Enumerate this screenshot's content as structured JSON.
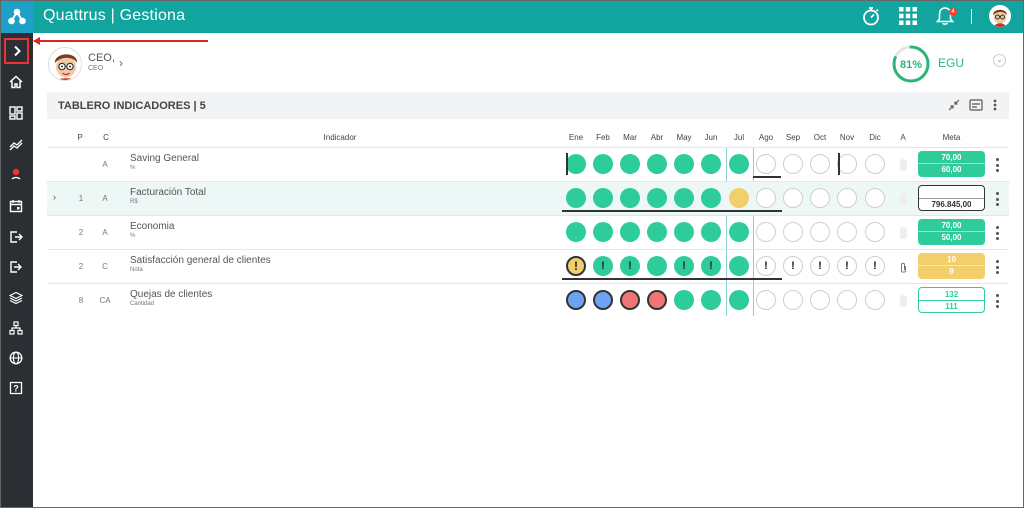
{
  "topbar": {
    "title": "Quattrus | Gestiona",
    "notification_count": "4"
  },
  "icons": {
    "logo": "quattrus-logo-icon",
    "timer": "stopwatch-icon",
    "apps": "grid-apps-icon",
    "bell": "bell-icon"
  },
  "sidebar": {
    "items": [
      "chevron-right-icon",
      "home-icon",
      "dashboard-icon",
      "trend-icon",
      "location-icon",
      "calendar-icon",
      "logout-icon",
      "export-icon",
      "layers-icon",
      "org-chart-icon",
      "globe-icon",
      "help-icon"
    ]
  },
  "user": {
    "name": "CEO,",
    "role": "CEO",
    "chevron": "›"
  },
  "egu": {
    "percent": "81%",
    "label": "EGU",
    "value": 0.81,
    "color": "#2bb673"
  },
  "panel": {
    "title": "TABLERO INDICADORES | 5"
  },
  "columns": {
    "p": "P",
    "c": "C",
    "indicador": "Indicador",
    "months": [
      "Ene",
      "Feb",
      "Mar",
      "Abr",
      "May",
      "Jun",
      "Jul",
      "Ago",
      "Sep",
      "Oct",
      "Nov",
      "Dic"
    ],
    "a": "A",
    "meta": "Meta"
  },
  "rows": [
    {
      "expand": "",
      "p": "",
      "c": "A",
      "name": "Saving General",
      "unit": "%",
      "meta": [
        "70,00",
        "60,00"
      ],
      "meta_style": "green"
    },
    {
      "expand": "›",
      "p": "1",
      "c": "A",
      "name": "Facturación Total",
      "unit": "R$",
      "meta": [
        "",
        "796.845,00"
      ],
      "meta_style": "white"
    },
    {
      "expand": "",
      "p": "2",
      "c": "A",
      "name": "Economia",
      "unit": "%",
      "meta": [
        "70,00",
        "50,00"
      ],
      "meta_style": "green"
    },
    {
      "expand": "",
      "p": "2",
      "c": "C",
      "name": "Satisfacción general de clientes",
      "unit": "Nota",
      "meta": [
        "10",
        "9"
      ],
      "meta_style": "yellow"
    },
    {
      "expand": "",
      "p": "8",
      "c": "CA",
      "name": "Quejas de clientes",
      "unit": "Cantidad",
      "meta": [
        "132",
        "111"
      ],
      "meta_style": "outline"
    }
  ],
  "dot_glyph": "!",
  "colors": {
    "teal": "#12a5a0",
    "green": "#2ecc9a",
    "yellow": "#f3cf6b",
    "blue": "#6ea2f2",
    "red": "#f07575"
  }
}
